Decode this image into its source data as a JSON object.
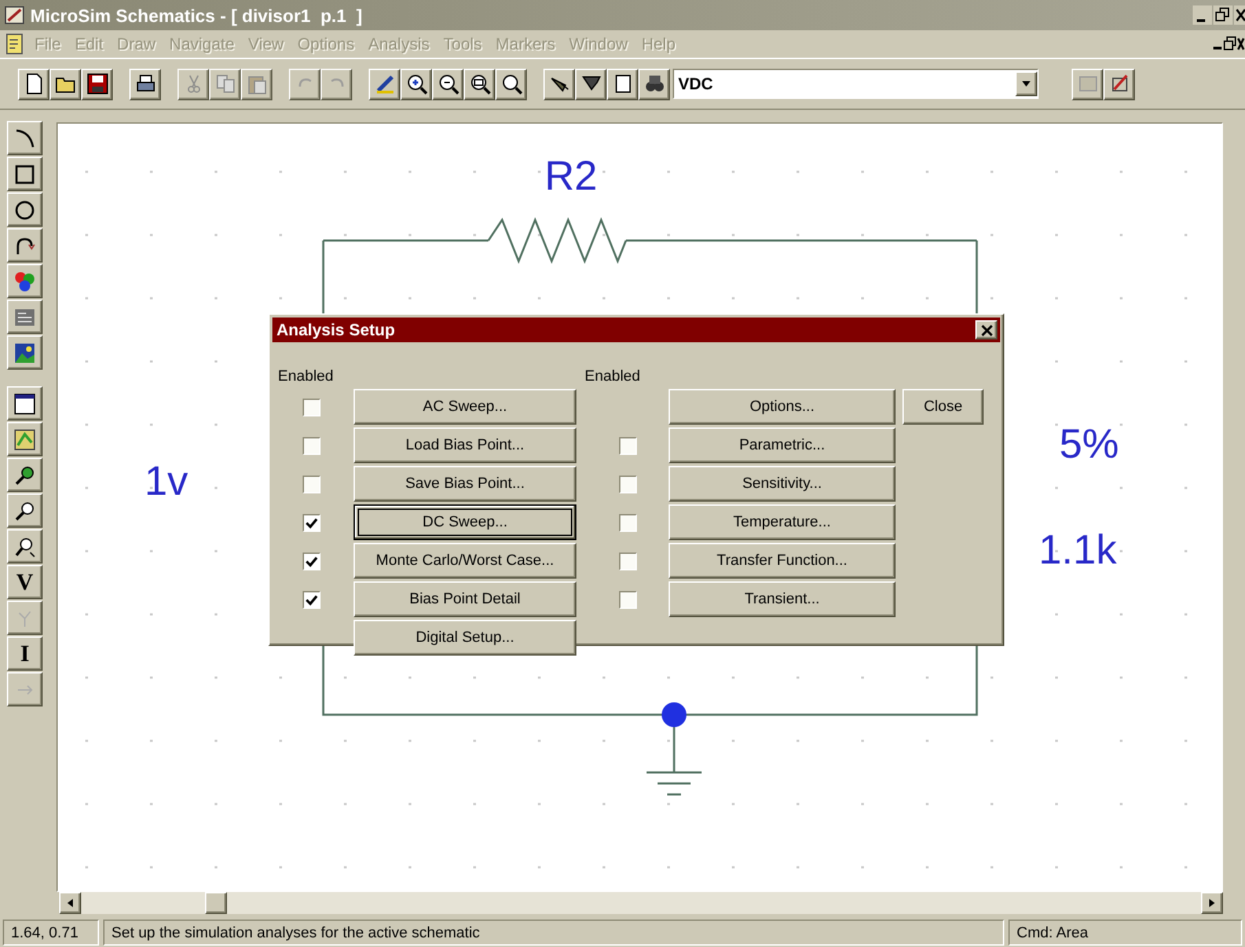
{
  "window": {
    "title": "MicroSim Schematics - [ divisor1  p.1  ]"
  },
  "menu": [
    {
      "label": "File",
      "disabled": true
    },
    {
      "label": "Edit",
      "disabled": true
    },
    {
      "label": "Draw",
      "disabled": true
    },
    {
      "label": "Navigate",
      "disabled": true
    },
    {
      "label": "View",
      "disabled": true
    },
    {
      "label": "Options",
      "disabled": true
    },
    {
      "label": "Analysis",
      "disabled": true
    },
    {
      "label": "Tools",
      "disabled": true
    },
    {
      "label": "Markers",
      "disabled": true
    },
    {
      "label": "Window",
      "disabled": true
    },
    {
      "label": "Help",
      "disabled": true
    }
  ],
  "toolbar": {
    "part_field": {
      "value": "VDC"
    }
  },
  "tool_palette": {
    "voltage_marker": "V",
    "current_marker": "I"
  },
  "schematic": {
    "labels": [
      {
        "kind": "refdes",
        "text": "R2"
      },
      {
        "kind": "source",
        "text": "1v"
      },
      {
        "kind": "tolerance",
        "text": "5%"
      },
      {
        "kind": "value",
        "text": "1.1k"
      }
    ]
  },
  "dialog": {
    "title": "Analysis Setup",
    "enabled_header_left": "Enabled",
    "enabled_header_right": "Enabled",
    "left": [
      {
        "label": "AC Sweep...",
        "kind": "toggle",
        "enabled": false,
        "focused": false
      },
      {
        "label": "Load Bias Point...",
        "kind": "toggle",
        "enabled": false,
        "focused": false
      },
      {
        "label": "Save Bias Point...",
        "kind": "toggle",
        "enabled": false,
        "focused": false
      },
      {
        "label": "DC Sweep...",
        "kind": "toggle",
        "enabled": true,
        "focused": true
      },
      {
        "label": "Monte Carlo/Worst Case...",
        "kind": "toggle",
        "enabled": true,
        "focused": false
      },
      {
        "label": "Bias Point Detail",
        "kind": "toggle",
        "enabled": true,
        "focused": false
      },
      {
        "label": "Digital Setup...",
        "kind": "button",
        "focused": false
      }
    ],
    "right": [
      {
        "label": "Options...",
        "kind": "button"
      },
      {
        "label": "Parametric...",
        "kind": "toggle",
        "enabled": false
      },
      {
        "label": "Sensitivity...",
        "kind": "toggle",
        "enabled": false
      },
      {
        "label": "Temperature...",
        "kind": "toggle",
        "enabled": false
      },
      {
        "label": "Transfer Function...",
        "kind": "toggle",
        "enabled": false
      },
      {
        "label": "Transient...",
        "kind": "toggle",
        "enabled": false
      }
    ],
    "close_button": "Close"
  },
  "status_bar": {
    "coordinates": "1.64,  0.71",
    "message": "Set up the simulation analyses for the active schematic",
    "command": "Cmd: Area"
  }
}
